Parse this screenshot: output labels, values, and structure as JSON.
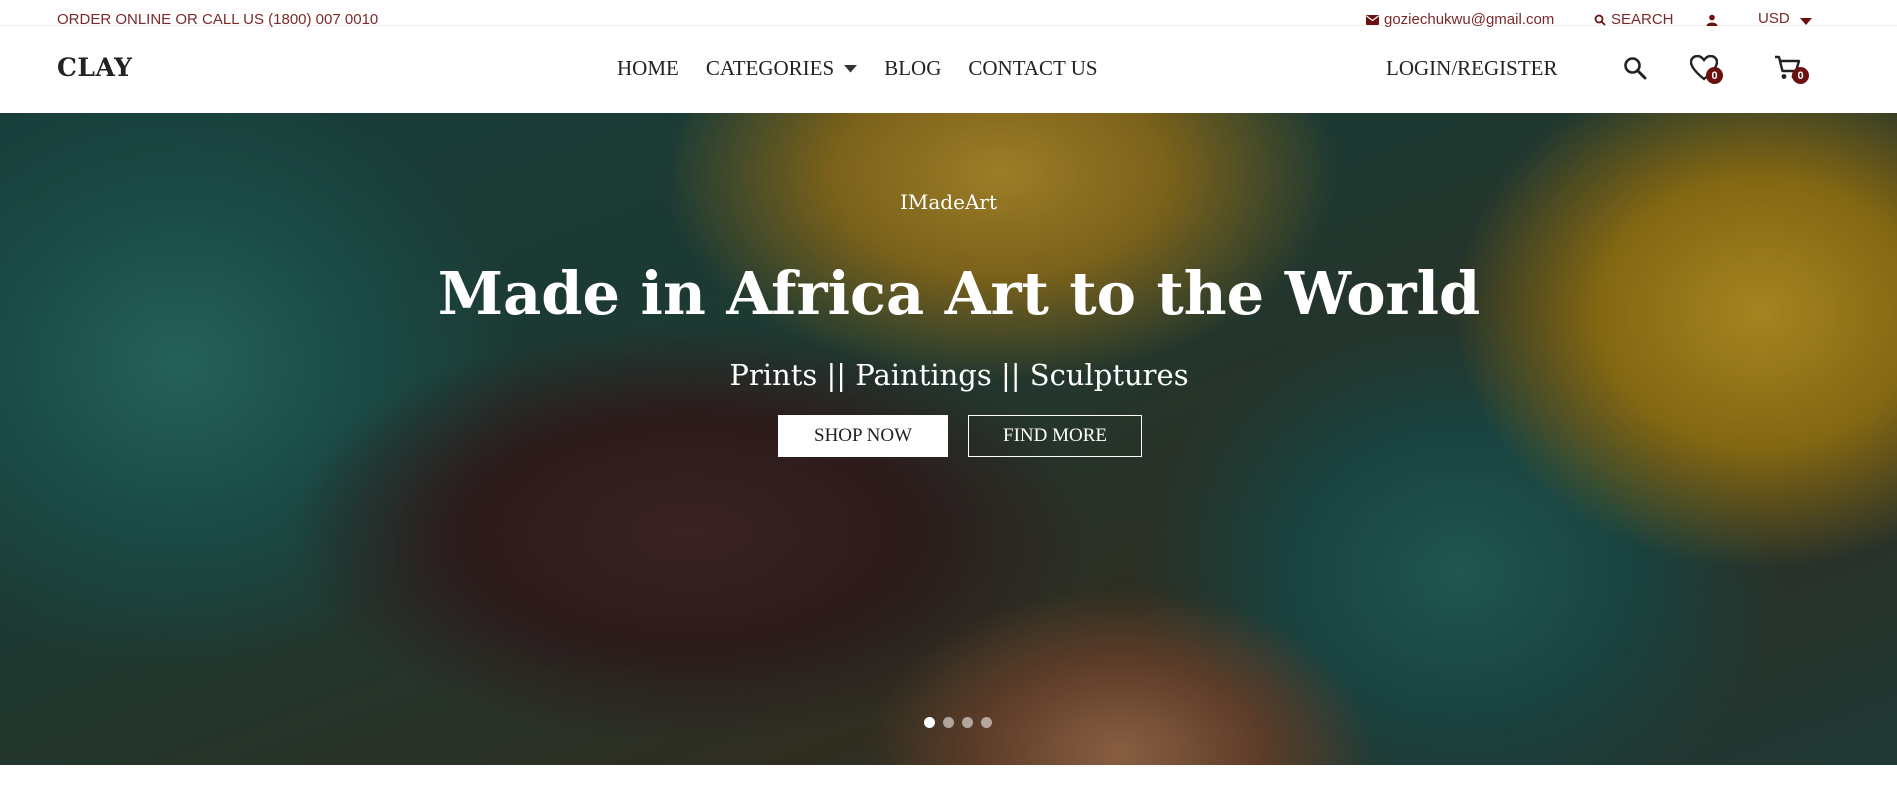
{
  "topbar": {
    "phone_text": "ORDER ONLINE OR CALL US (1800) 007 0010",
    "email": "goziechukwu@gmail.com",
    "search_label": "SEARCH",
    "currency": "USD"
  },
  "header": {
    "logo": "CLAY",
    "nav": [
      {
        "label": "HOME"
      },
      {
        "label": "CATEGORIES",
        "has_dropdown": true
      },
      {
        "label": "BLOG"
      },
      {
        "label": "CONTACT US"
      }
    ],
    "login_label": "LOGIN/REGISTER",
    "wishlist_count": "0",
    "cart_count": "0"
  },
  "hero": {
    "eyebrow": "IMadeArt",
    "headline": "Made in Africa Art to the World",
    "subline": "Prints || Paintings || Sculptures",
    "primary_button": "SHOP NOW",
    "secondary_button": "FIND MORE",
    "slide_count": 4,
    "active_slide": 1
  },
  "colors": {
    "accent": "#6b0f0f",
    "topbar_text": "#7a2a2a"
  },
  "icons": {
    "email": "envelope-icon",
    "search": "search-icon",
    "user": "user-icon",
    "currency_dropdown": "caret-down-icon",
    "wishlist": "heart-icon",
    "cart": "cart-icon"
  }
}
